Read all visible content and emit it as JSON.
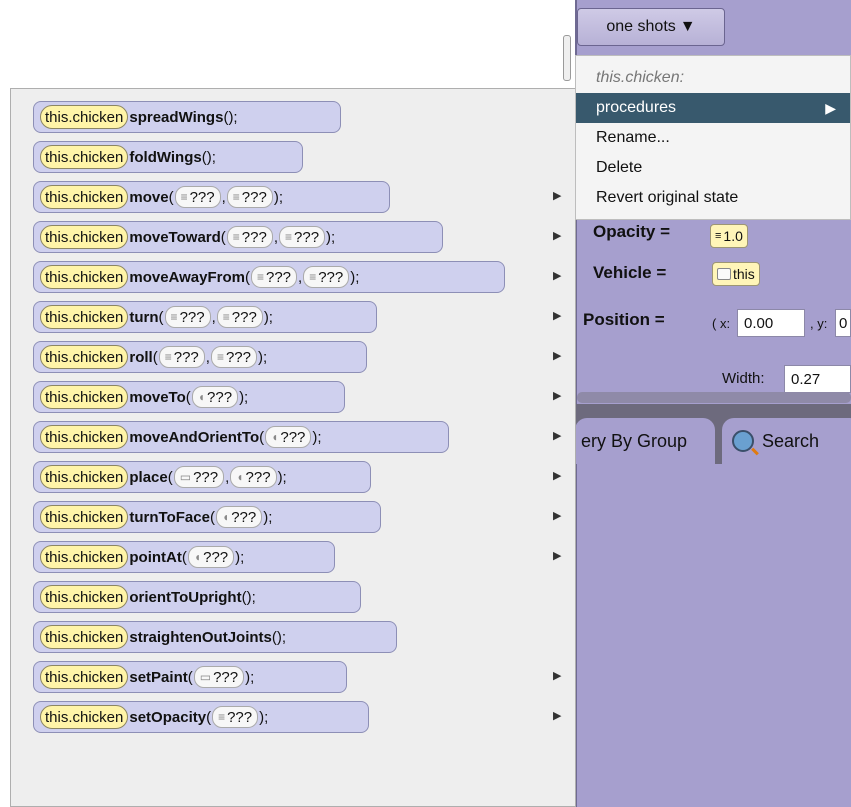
{
  "toolbar": {
    "oneshots_label": "one shots",
    "dropdown_icon": "▼"
  },
  "context_menu": {
    "header": "this.chicken:",
    "items": [
      {
        "label": "procedures",
        "arrow": "▶"
      },
      {
        "label": "Rename..."
      },
      {
        "label": "Delete"
      },
      {
        "label": "Revert original state"
      }
    ]
  },
  "properties": {
    "opacity": {
      "label": "Opacity =",
      "value": "1.0"
    },
    "vehicle": {
      "label": "Vehicle =",
      "value": "this"
    },
    "position": {
      "label": "Position =",
      "x_label": "( x:",
      "x_value": "0.00",
      "y_label": ", y:",
      "y_value": "0"
    },
    "width": {
      "label": "Width:",
      "value": "0.27"
    }
  },
  "tabs": [
    {
      "label": "ery By Group"
    },
    {
      "label": "Search"
    }
  ],
  "procedures": [
    {
      "target": "this.chicken",
      "name": "spreadWings",
      "args": [],
      "has_arrow": false
    },
    {
      "target": "this.chicken",
      "name": "foldWings",
      "args": [],
      "has_arrow": false
    },
    {
      "target": "this.chicken",
      "name": "move",
      "args": [
        "???",
        "???"
      ],
      "has_arrow": true
    },
    {
      "target": "this.chicken",
      "name": "moveToward",
      "args": [
        "???",
        "???"
      ],
      "has_arrow": true
    },
    {
      "target": "this.chicken",
      "name": "moveAwayFrom",
      "args": [
        "???",
        "???"
      ],
      "has_arrow": true
    },
    {
      "target": "this.chicken",
      "name": "turn",
      "args": [
        "???",
        "???"
      ],
      "has_arrow": true
    },
    {
      "target": "this.chicken",
      "name": "roll",
      "args": [
        "???",
        "???"
      ],
      "has_arrow": true
    },
    {
      "target": "this.chicken",
      "name": "moveTo",
      "args": [
        "???"
      ],
      "has_arrow": true
    },
    {
      "target": "this.chicken",
      "name": "moveAndOrientTo",
      "args": [
        "???"
      ],
      "has_arrow": true
    },
    {
      "target": "this.chicken",
      "name": "place",
      "args": [
        "???",
        "???"
      ],
      "has_arrow": true
    },
    {
      "target": "this.chicken",
      "name": "turnToFace",
      "args": [
        "???"
      ],
      "has_arrow": true
    },
    {
      "target": "this.chicken",
      "name": "pointAt",
      "args": [
        "???"
      ],
      "has_arrow": true
    },
    {
      "target": "this.chicken",
      "name": "orientToUpright",
      "args": [],
      "has_arrow": false
    },
    {
      "target": "this.chicken",
      "name": "straightenOutJoints",
      "args": [],
      "has_arrow": false
    },
    {
      "target": "this.chicken",
      "name": "setPaint",
      "args": [
        "???"
      ],
      "has_arrow": true
    },
    {
      "target": "this.chicken",
      "name": "setOpacity",
      "args": [
        "???"
      ],
      "has_arrow": true
    }
  ],
  "submenu_arrow": "▶"
}
